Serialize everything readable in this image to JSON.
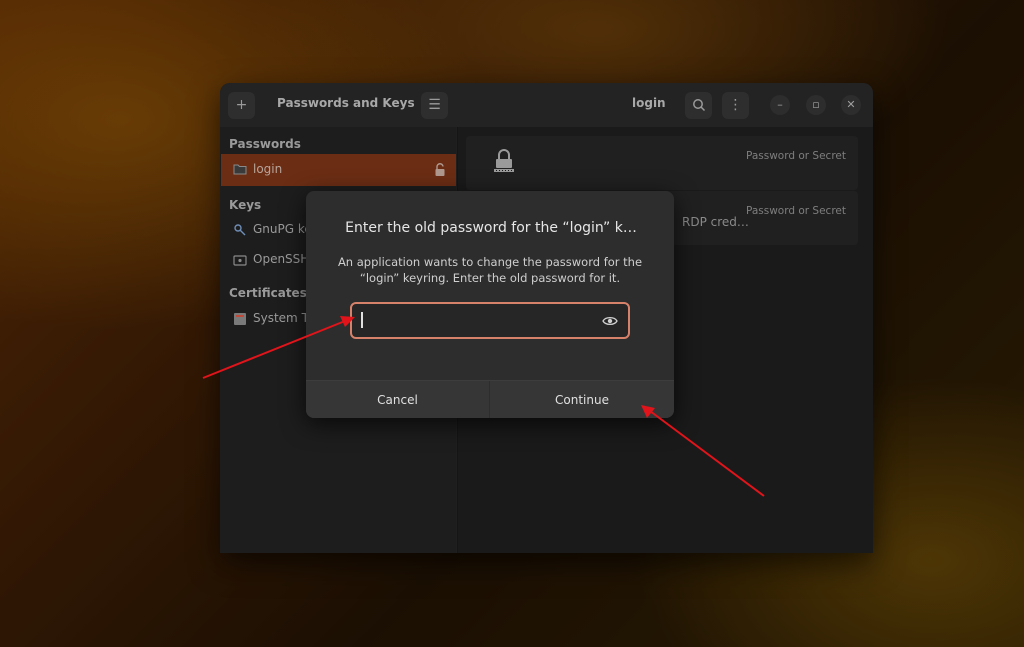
{
  "app": {
    "title": "Passwords and Keys",
    "view_title": "login",
    "add_icon": "plus-icon",
    "menu_icon": "hamburger-icon",
    "search_icon": "search-icon",
    "kebab_icon": "kebab-icon",
    "window_controls": [
      "minimize-icon",
      "maximize-icon",
      "close-icon"
    ]
  },
  "sidebar": {
    "passwords_title": "Passwords",
    "keys_title": "Keys",
    "certificates_title": "Certificates",
    "items": [
      {
        "label": "login",
        "icon": "folder-icon",
        "selected": true,
        "lock_icon": "unlocked-padlock-icon"
      },
      {
        "label": "GnuPG ke",
        "icon": "key-icon"
      },
      {
        "label": "OpenSSH",
        "icon": "ssh-key-icon"
      },
      {
        "label": "System T",
        "icon": "certificate-icon"
      }
    ]
  },
  "content": {
    "items": [
      {
        "name": "",
        "kind": "Password or Secret"
      },
      {
        "name": "RDP cred…",
        "kind": "Password or Secret"
      }
    ]
  },
  "dialog": {
    "title": "Enter the old password for the “login” k…",
    "message": "An application wants to change the password for the “login” keyring. Enter the old password for it.",
    "password_value": "",
    "reveal_icon": "eye-icon",
    "cancel_label": "Cancel",
    "continue_label": "Continue"
  },
  "colors": {
    "accent": "#d6826a",
    "selected_row": "#6b2d14",
    "annotation_arrow": "#e0141a"
  }
}
